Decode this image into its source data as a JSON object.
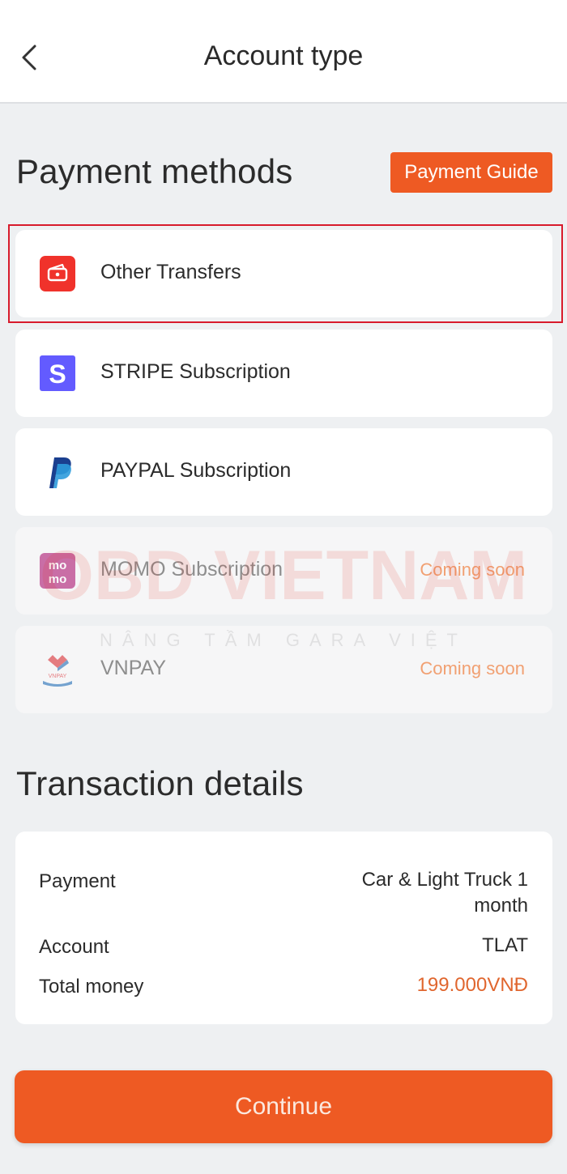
{
  "header": {
    "title": "Account type",
    "back_icon": "chevron-left-icon"
  },
  "payment_methods": {
    "heading": "Payment methods",
    "guide_button": "Payment Guide",
    "selected": "Other Transfers",
    "items": [
      {
        "label": "Other Transfers",
        "icon": "wallet-icon",
        "status": ""
      },
      {
        "label": "STRIPE Subscription",
        "icon": "stripe-icon",
        "status": ""
      },
      {
        "label": "PAYPAL Subscription",
        "icon": "paypal-icon",
        "status": ""
      },
      {
        "label": "MOMO Subscription",
        "icon": "momo-icon",
        "status": "Coming soon"
      },
      {
        "label": "VNPAY",
        "icon": "vnpay-icon",
        "status": "Coming soon"
      }
    ]
  },
  "watermark": {
    "brand": "OBD VIETNAM",
    "tagline": "NÂNG TẦM GARA VIỆT"
  },
  "transaction": {
    "heading": "Transaction details",
    "rows": [
      {
        "label": "Payment",
        "value_line1": "Car & Light Truck 1",
        "value_line2": "month"
      },
      {
        "label": "Account",
        "value": "TLAT"
      },
      {
        "label": "Total money",
        "value": "199.000VNĐ"
      }
    ]
  },
  "footer": {
    "continue_button": "Continue"
  },
  "colors": {
    "accent": "#ee5a23",
    "selection_outline": "#d81b2c",
    "money": "#e0662e",
    "coming_soon": "#f1a072"
  }
}
